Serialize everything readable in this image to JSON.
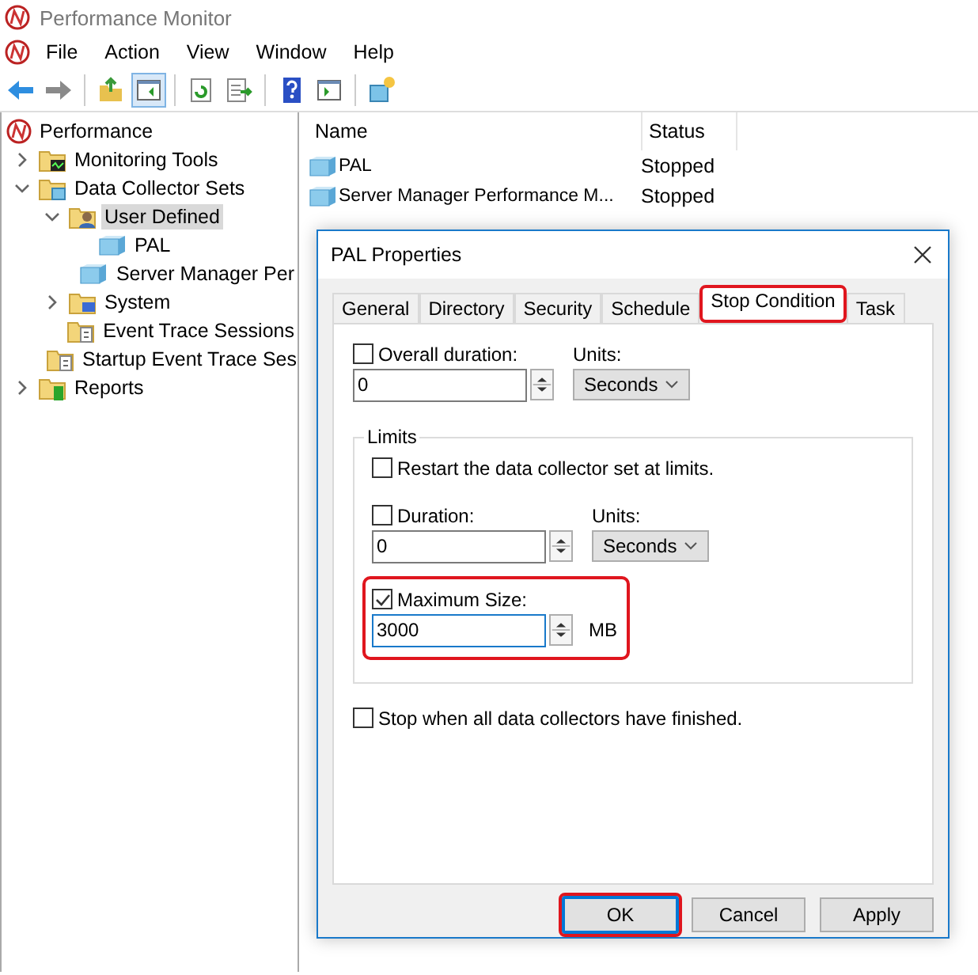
{
  "window": {
    "title": "Performance Monitor"
  },
  "menu": [
    "File",
    "Action",
    "View",
    "Window",
    "Help"
  ],
  "toolbar": [
    {
      "kind": "back",
      "pressed": false
    },
    {
      "kind": "forward",
      "pressed": false
    },
    {
      "kind": "sep"
    },
    {
      "kind": "up",
      "pressed": false
    },
    {
      "kind": "tree",
      "pressed": true
    },
    {
      "kind": "sep"
    },
    {
      "kind": "refresh",
      "pressed": false
    },
    {
      "kind": "export",
      "pressed": false
    },
    {
      "kind": "sep"
    },
    {
      "kind": "help",
      "pressed": false
    },
    {
      "kind": "pane",
      "pressed": false
    },
    {
      "kind": "sep"
    },
    {
      "kind": "new",
      "pressed": false
    }
  ],
  "tree": [
    {
      "label": "Performance",
      "kind": "perf",
      "selected": false,
      "children": [
        {
          "label": "Monitoring Tools",
          "kind": "chart",
          "expanded": false,
          "selected": false
        },
        {
          "label": "Data Collector Sets",
          "kind": "sets",
          "expanded": true,
          "selected": false,
          "children": [
            {
              "label": "User Defined",
              "kind": "user",
              "expanded": true,
              "selected": true,
              "children": [
                {
                  "label": "PAL",
                  "kind": "set",
                  "selected": false
                },
                {
                  "label": "Server Manager Per",
                  "kind": "set",
                  "selected": false
                }
              ]
            },
            {
              "label": "System",
              "kind": "system",
              "expanded": false,
              "selected": false
            },
            {
              "label": "Event Trace Sessions",
              "kind": "trace",
              "selected": false
            },
            {
              "label": "Startup Event Trace Ses",
              "kind": "trace",
              "selected": false
            }
          ]
        },
        {
          "label": "Reports",
          "kind": "report",
          "expanded": false,
          "selected": false
        }
      ]
    }
  ],
  "list": {
    "columns": [
      "Name",
      "Status"
    ],
    "rows": [
      {
        "name": "PAL",
        "status": "Stopped"
      },
      {
        "name": "Server Manager Performance M...",
        "status": "Stopped"
      }
    ]
  },
  "dialog": {
    "title": "PAL Properties",
    "tabs": [
      {
        "label": "General",
        "selected": false,
        "highlighted": false
      },
      {
        "label": "Directory",
        "selected": false,
        "highlighted": false
      },
      {
        "label": "Security",
        "selected": false,
        "highlighted": false
      },
      {
        "label": "Schedule",
        "selected": false,
        "highlighted": false
      },
      {
        "label": "Stop Condition",
        "selected": true,
        "highlighted": true
      },
      {
        "label": "Task",
        "selected": false,
        "highlighted": false
      }
    ],
    "overall": {
      "label": "Overall duration:",
      "checked": false,
      "value": "0",
      "units_label": "Units:",
      "units": "Seconds"
    },
    "limits": {
      "title": "Limits",
      "restart": {
        "label": "Restart the data collector set at limits.",
        "checked": false
      },
      "duration": {
        "label": "Duration:",
        "checked": false,
        "value": "0",
        "units_label": "Units:",
        "units": "Seconds"
      },
      "max_size": {
        "label": "Maximum Size:",
        "checked": true,
        "value": "3000",
        "unit": "MB",
        "highlighted": true
      }
    },
    "stop_when": {
      "label": "Stop when all data collectors have finished.",
      "checked": false
    },
    "buttons": [
      {
        "label": "OK",
        "default": true,
        "highlighted": true
      },
      {
        "label": "Cancel",
        "default": false,
        "highlighted": false
      },
      {
        "label": "Apply",
        "default": false,
        "highlighted": false
      }
    ]
  }
}
